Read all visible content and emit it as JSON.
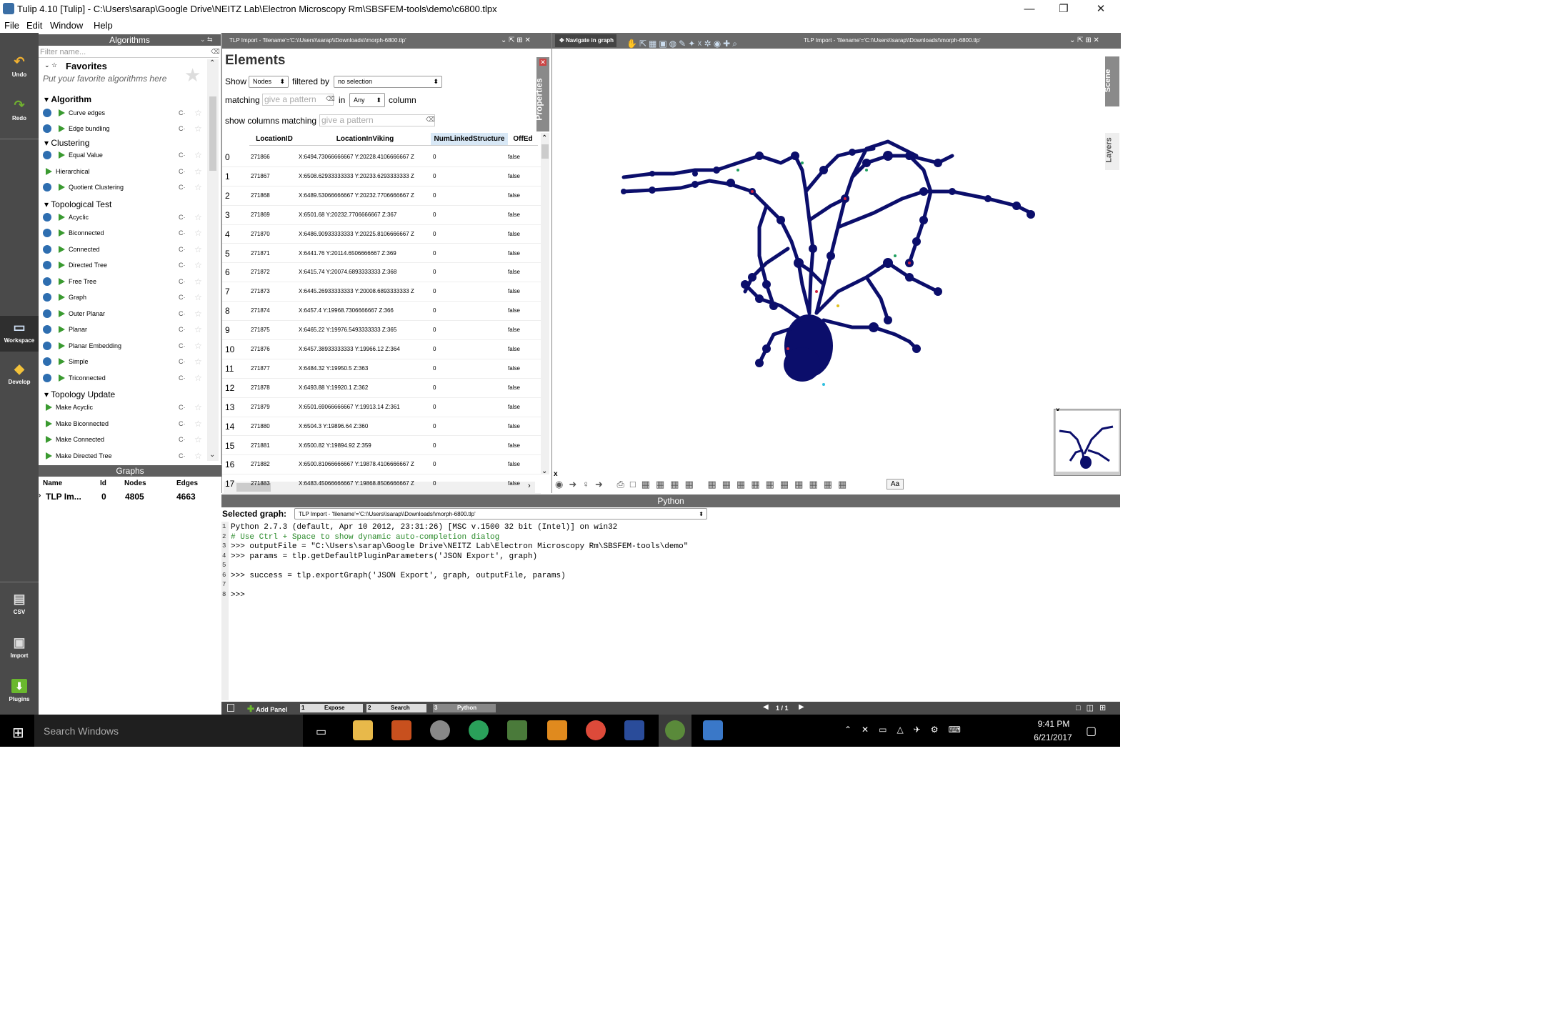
{
  "window": {
    "title": "Tulip 4.10 [Tulip] - C:\\Users\\sarap\\Google Drive\\NEITZ Lab\\Electron Microscopy Rm\\SBSFEM-tools\\demo\\c6800.tlpx",
    "minimize": "—",
    "restore": "❐",
    "close": "✕"
  },
  "menu": [
    "File",
    "Edit",
    "Window",
    "Help"
  ],
  "leftbar": {
    "undo": "Undo",
    "redo": "Redo",
    "workspace": "Workspace",
    "develop": "Develop",
    "csv": "CSV",
    "import": "Import",
    "plugins": "Plugins"
  },
  "algorithms": {
    "title": "Algorithms",
    "filter_placeholder": "Filter name...",
    "favorites_title": "Favorites",
    "favorites_hint": "Put your favorite algorithms here",
    "categories": {
      "algorithm": "Algorithm",
      "clustering": "Clustering",
      "topo_test": "Topological Test",
      "topo_update": "Topology Update"
    },
    "items": {
      "curve_edges": "Curve edges",
      "edge_bundling": "Edge bundling",
      "equal_value": "Equal Value",
      "hierarchical": "Hierarchical",
      "quotient_clustering": "Quotient Clustering",
      "acyclic": "Acyclic",
      "biconnected": "Biconnected",
      "connected": "Connected",
      "directed_tree": "Directed Tree",
      "free_tree": "Free Tree",
      "graph": "Graph",
      "outer_planar": "Outer Planar",
      "planar": "Planar",
      "planar_embedding": "Planar Embedding",
      "simple": "Simple",
      "triconnected": "Triconnected",
      "make_acyclic": "Make Acyclic",
      "make_biconnected": "Make Biconnected",
      "make_connected": "Make Connected",
      "make_directed_tree": "Make Directed Tree"
    },
    "run_glyph": "C·",
    "star_glyph": "☆"
  },
  "graphs": {
    "title": "Graphs",
    "headers": {
      "name": "Name",
      "id": "Id",
      "nodes": "Nodes",
      "edges": "Edges"
    },
    "row": {
      "name": "TLP Im...",
      "id": "0",
      "nodes": "4805",
      "edges": "4663"
    }
  },
  "table_panel": {
    "tab_title": "TLP Import - 'filename'='C:\\\\Users\\\\sarap\\\\Downloads\\\\morph-6800.tlp'",
    "heading": "Elements",
    "show_label": "Show",
    "show_value": "Nodes",
    "filtered_by_label": "filtered by",
    "filtered_by_value": "no selection",
    "matching_label": "matching",
    "pattern_placeholder": "give a pattern",
    "in_label": "in",
    "in_value": "Any",
    "column_label": "column",
    "show_columns_label": "show columns matching",
    "columns_pattern_placeholder": "give a pattern",
    "properties_tab": "Properties",
    "columns": [
      "LocationID",
      "LocationInViking",
      "NumLinkedStructure",
      "OffEd"
    ],
    "rows": [
      {
        "idx": "0",
        "id": "271866",
        "loc": "X:6494.73066666667 Y:20228.4106666667 Z",
        "num": "0",
        "off": "false"
      },
      {
        "idx": "1",
        "id": "271867",
        "loc": "X:6508.62933333333 Y:20233.6293333333 Z",
        "num": "0",
        "off": "false"
      },
      {
        "idx": "2",
        "id": "271868",
        "loc": "X:6489.53066666667 Y:20232.7706666667 Z",
        "num": "0",
        "off": "false"
      },
      {
        "idx": "3",
        "id": "271869",
        "loc": "X:6501.68 Y:20232.7706666667 Z:367",
        "num": "0",
        "off": "false"
      },
      {
        "idx": "4",
        "id": "271870",
        "loc": "X:6486.90933333333 Y:20225.8106666667 Z",
        "num": "0",
        "off": "false"
      },
      {
        "idx": "5",
        "id": "271871",
        "loc": "X:6441.76 Y:20114.6506666667 Z:369",
        "num": "0",
        "off": "false"
      },
      {
        "idx": "6",
        "id": "271872",
        "loc": "X:6415.74 Y:20074.6893333333 Z:368",
        "num": "0",
        "off": "false"
      },
      {
        "idx": "7",
        "id": "271873",
        "loc": "X:6445.26933333333 Y:20008.6893333333 Z",
        "num": "0",
        "off": "false"
      },
      {
        "idx": "8",
        "id": "271874",
        "loc": "X:6457.4 Y:19968.7306666667 Z:366",
        "num": "0",
        "off": "false"
      },
      {
        "idx": "9",
        "id": "271875",
        "loc": "X:6465.22 Y:19976.5493333333 Z:365",
        "num": "0",
        "off": "false"
      },
      {
        "idx": "10",
        "id": "271876",
        "loc": "X:6457.38933333333 Y:19966.12 Z:364",
        "num": "0",
        "off": "false"
      },
      {
        "idx": "11",
        "id": "271877",
        "loc": "X:6484.32 Y:19950.5 Z:363",
        "num": "0",
        "off": "false"
      },
      {
        "idx": "12",
        "id": "271878",
        "loc": "X:6493.88 Y:19920.1 Z:362",
        "num": "0",
        "off": "false"
      },
      {
        "idx": "13",
        "id": "271879",
        "loc": "X:6501.69066666667 Y:19913.14 Z:361",
        "num": "0",
        "off": "false"
      },
      {
        "idx": "14",
        "id": "271880",
        "loc": "X:6504.3 Y:19896.64 Z:360",
        "num": "0",
        "off": "false"
      },
      {
        "idx": "15",
        "id": "271881",
        "loc": "X:6500.82 Y:19894.92 Z:359",
        "num": "0",
        "off": "false"
      },
      {
        "idx": "16",
        "id": "271882",
        "loc": "X:6500.81066666667 Y:19878.4106666667 Z",
        "num": "0",
        "off": "false"
      },
      {
        "idx": "17",
        "id": "271883",
        "loc": "X:6483.45066666667 Y:19868.8506666667 Z",
        "num": "0",
        "off": "false"
      }
    ]
  },
  "graph_view": {
    "mode_label": "Navigate in graph",
    "tab_title": "TLP Import - 'filename'='C:\\\\Users\\\\sarap\\\\Downloads\\\\morph-6800.tlp'",
    "scene_tab": "Scene",
    "layers_tab": "Layers",
    "overview_close": "x",
    "toolbar_close": "x",
    "font_button": "Aa",
    "node_color": "#0b0e6b"
  },
  "python": {
    "title": "Python",
    "selected_graph_label": "Selected graph:",
    "selected_graph_value": "TLP Import - 'filename'='C:\\\\Users\\\\sarap\\\\Downloads\\\\morph-6800.tlp'",
    "lines": [
      "Python 2.7.3 (default, Apr 10 2012, 23:31:26) [MSC v.1500 32 bit (Intel)] on win32",
      "# Use Ctrl + Space to show dynamic auto-completion dialog",
      ">>> outputFile = \"C:\\Users\\sarap\\Google Drive\\NEITZ Lab\\Electron Microscopy Rm\\SBSFEM-tools\\demo\"",
      ">>> params = tlp.getDefaultPluginParameters('JSON Export', graph)",
      "",
      ">>> success = tlp.exportGraph('JSON Export', graph, outputFile, params)",
      "",
      ">>> "
    ]
  },
  "bottombar": {
    "add_panel": "Add Panel",
    "tab1_num": "1",
    "tab1": "Expose",
    "tab2_num": "2",
    "tab2": "Search",
    "tab3_num": "3",
    "tab3": "Python",
    "page": "1 / 1"
  },
  "taskbar": {
    "search_placeholder": "Search Windows",
    "time": "9:41 PM",
    "date": "6/21/2017"
  }
}
